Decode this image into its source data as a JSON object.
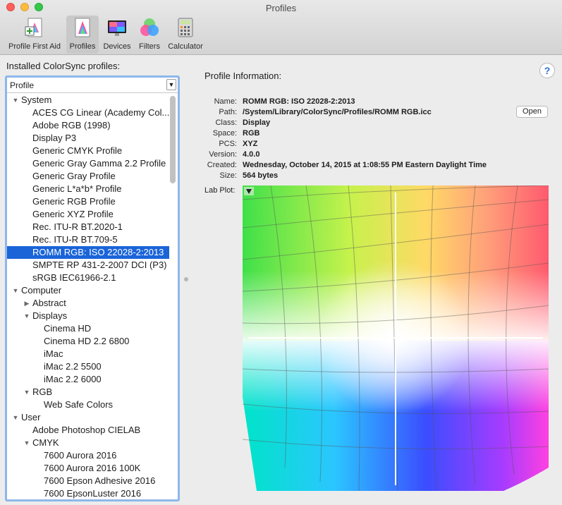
{
  "window": {
    "title": "Profiles"
  },
  "toolbar": {
    "items": [
      {
        "label": "Profile First Aid",
        "icon": "profile-first-aid-icon"
      },
      {
        "label": "Profiles",
        "icon": "profiles-icon",
        "selected": true
      },
      {
        "label": "Devices",
        "icon": "devices-icon"
      },
      {
        "label": "Filters",
        "icon": "filters-icon"
      },
      {
        "label": "Calculator",
        "icon": "calculator-icon"
      }
    ]
  },
  "sidebar": {
    "title": "Installed ColorSync profiles:",
    "header": "Profile",
    "rows": [
      {
        "label": "System",
        "level": 0,
        "disclosure": "open"
      },
      {
        "label": "ACES CG Linear (Academy Col...",
        "level": 1
      },
      {
        "label": "Adobe RGB (1998)",
        "level": 1
      },
      {
        "label": "Display P3",
        "level": 1
      },
      {
        "label": "Generic CMYK Profile",
        "level": 1
      },
      {
        "label": "Generic Gray Gamma 2.2 Profile",
        "level": 1
      },
      {
        "label": "Generic Gray Profile",
        "level": 1
      },
      {
        "label": "Generic L*a*b* Profile",
        "level": 1
      },
      {
        "label": "Generic RGB Profile",
        "level": 1
      },
      {
        "label": "Generic XYZ Profile",
        "level": 1
      },
      {
        "label": "Rec. ITU-R BT.2020-1",
        "level": 1
      },
      {
        "label": "Rec. ITU-R BT.709-5",
        "level": 1
      },
      {
        "label": "ROMM RGB: ISO 22028-2:2013",
        "level": 1,
        "selected": true
      },
      {
        "label": "SMPTE RP 431-2-2007 DCI (P3)",
        "level": 1
      },
      {
        "label": "sRGB IEC61966-2.1",
        "level": 1
      },
      {
        "label": "Computer",
        "level": 0,
        "disclosure": "open"
      },
      {
        "label": "Abstract",
        "level": 1,
        "disclosure": "closed"
      },
      {
        "label": "Displays",
        "level": 1,
        "disclosure": "open"
      },
      {
        "label": "Cinema HD",
        "level": 2
      },
      {
        "label": "Cinema HD 2.2 6800",
        "level": 2
      },
      {
        "label": "iMac",
        "level": 2
      },
      {
        "label": "iMac 2.2 5500",
        "level": 2
      },
      {
        "label": "iMac 2.2 6000",
        "level": 2
      },
      {
        "label": "RGB",
        "level": 1,
        "disclosure": "open"
      },
      {
        "label": "Web Safe Colors",
        "level": 2
      },
      {
        "label": "User",
        "level": 0,
        "disclosure": "open"
      },
      {
        "label": "Adobe Photoshop CIELAB",
        "level": 1
      },
      {
        "label": "CMYK",
        "level": 1,
        "disclosure": "open"
      },
      {
        "label": "7600 Aurora 2016",
        "level": 2
      },
      {
        "label": "7600 Aurora 2016 100K",
        "level": 2
      },
      {
        "label": "7600 Epson Adhesive 2016",
        "level": 2
      },
      {
        "label": "7600 EpsonLuster 2016",
        "level": 2
      }
    ]
  },
  "info": {
    "title": "Profile Information:",
    "help": "?",
    "open_label": "Open",
    "fields": [
      {
        "key": "Name:",
        "value": "ROMM RGB: ISO 22028-2:2013"
      },
      {
        "key": "Path:",
        "value": "/System/Library/ColorSync/Profiles/ROMM RGB.icc"
      },
      {
        "key": "Class:",
        "value": "Display"
      },
      {
        "key": "Space:",
        "value": "RGB"
      },
      {
        "key": "PCS:",
        "value": "XYZ"
      },
      {
        "key": "Version:",
        "value": "4.0.0"
      },
      {
        "key": "Created:",
        "value": "Wednesday, October 14, 2015 at 1:08:55 PM Eastern Daylight Time"
      },
      {
        "key": "Size:",
        "value": "564 bytes"
      }
    ],
    "lab_plot_label": "Lab Plot:"
  },
  "colors": {
    "selection": "#1a64d8",
    "focus_ring": "#8db7ea"
  }
}
